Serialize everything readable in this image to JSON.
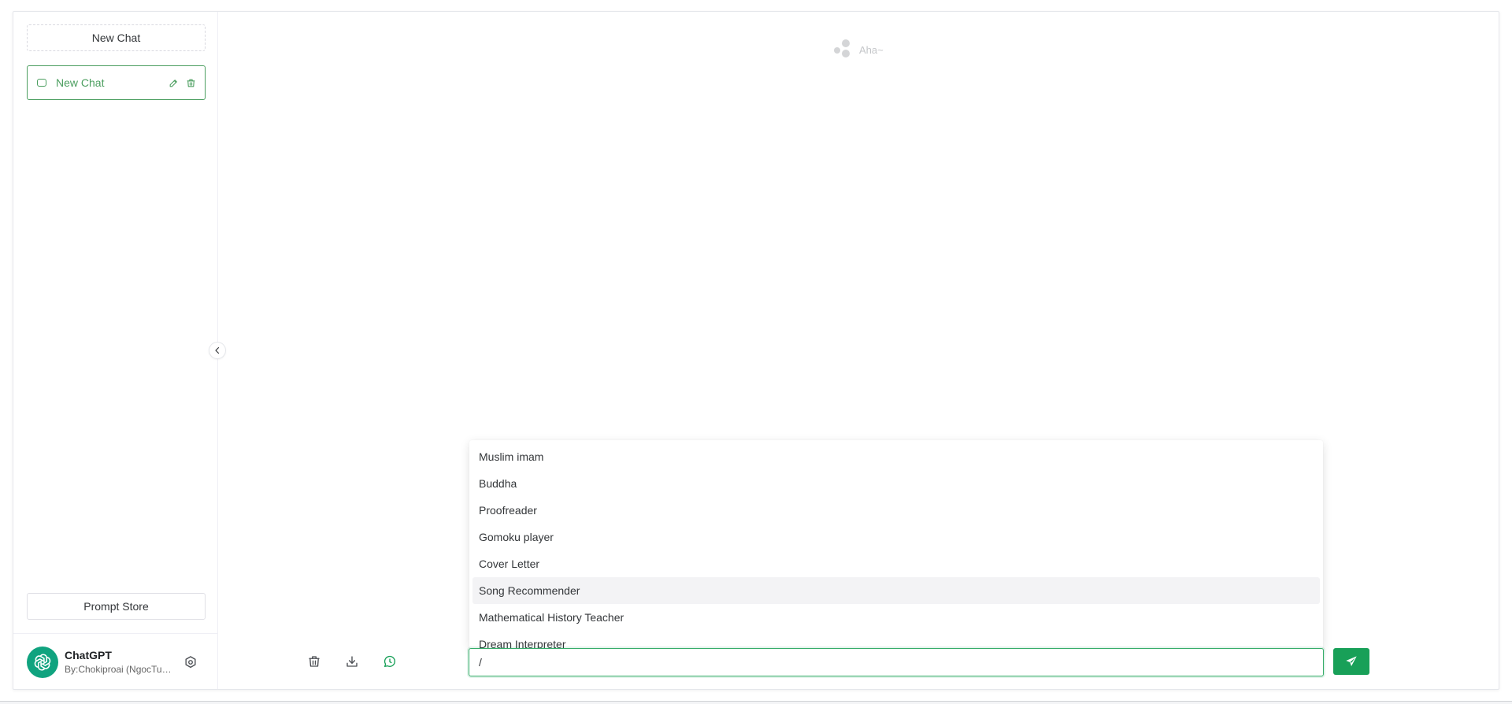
{
  "sidebar": {
    "new_chat_label": "New Chat",
    "chats": [
      {
        "label": "New Chat"
      }
    ],
    "prompt_store_label": "Prompt Store",
    "user": {
      "name": "ChatGPT",
      "description": "By:Chokiproai (NgocTuanHoang)"
    }
  },
  "main": {
    "empty_text": "Aha~",
    "prompt_options": [
      "Muslim imam",
      "Buddha",
      "Proofreader",
      "Gomoku player",
      "Cover Letter",
      "Song Recommender",
      "Mathematical History Teacher",
      "Dream Interpreter"
    ],
    "active_option_index": 5,
    "input": {
      "value": "/"
    }
  },
  "colors": {
    "accent": "#18a058",
    "active_border": "#4b9e5f",
    "avatar_bg": "#10a37f"
  },
  "icons": {
    "chat_item": "message-square-icon",
    "edit": "edit-icon",
    "delete": "trash-icon",
    "settings": "gear-icon",
    "collapse": "chevron-left-icon",
    "clear": "trash-icon",
    "download": "download-icon",
    "history": "whatsapp-icon",
    "send": "send-icon"
  }
}
